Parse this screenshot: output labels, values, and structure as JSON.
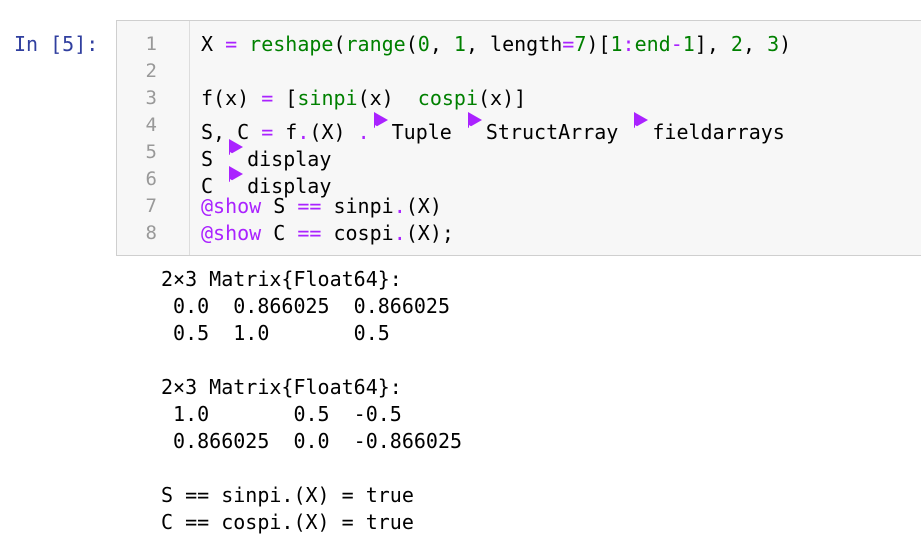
{
  "prompt": "In [5]:",
  "code": {
    "line_numbers": [
      "1",
      "2",
      "3",
      "4",
      "5",
      "6",
      "7",
      "8"
    ],
    "lines": [
      [
        {
          "t": "X",
          "c": "#000"
        },
        {
          "t": " = ",
          "c": "#aa22ff"
        },
        {
          "t": "reshape",
          "c": "#008000"
        },
        {
          "t": "(",
          "c": "#000"
        },
        {
          "t": "range",
          "c": "#008000"
        },
        {
          "t": "(",
          "c": "#000"
        },
        {
          "t": "0",
          "c": "#008000"
        },
        {
          "t": ", ",
          "c": "#000"
        },
        {
          "t": "1",
          "c": "#008000"
        },
        {
          "t": ", length",
          "c": "#000"
        },
        {
          "t": "=",
          "c": "#aa22ff"
        },
        {
          "t": "7",
          "c": "#008000"
        },
        {
          "t": ")[",
          "c": "#000"
        },
        {
          "t": "1",
          "c": "#008000"
        },
        {
          "t": ":",
          "c": "#aa22ff"
        },
        {
          "t": "end",
          "c": "#008000"
        },
        {
          "t": "-",
          "c": "#aa22ff"
        },
        {
          "t": "1",
          "c": "#008000"
        },
        {
          "t": "], ",
          "c": "#000"
        },
        {
          "t": "2",
          "c": "#008000"
        },
        {
          "t": ", ",
          "c": "#000"
        },
        {
          "t": "3",
          "c": "#008000"
        },
        {
          "t": ")",
          "c": "#000"
        }
      ],
      [],
      [
        {
          "t": "f",
          "c": "#000"
        },
        {
          "t": "(x) ",
          "c": "#000"
        },
        {
          "t": "=",
          "c": "#aa22ff"
        },
        {
          "t": " [",
          "c": "#000"
        },
        {
          "t": "sinpi",
          "c": "#008000"
        },
        {
          "t": "(x)  ",
          "c": "#000"
        },
        {
          "t": "cospi",
          "c": "#008000"
        },
        {
          "t": "(x)]",
          "c": "#000"
        }
      ],
      [
        {
          "t": "S, C ",
          "c": "#000"
        },
        {
          "t": "=",
          "c": "#aa22ff"
        },
        {
          "t": " f",
          "c": "#000"
        },
        {
          "t": ".",
          "c": "#aa22ff"
        },
        {
          "t": "(X) ",
          "c": "#000"
        },
        {
          "t": ".",
          "c": "#aa22ff"
        },
        {
          "tri": true
        },
        {
          "t": "Tuple ",
          "c": "#000"
        },
        {
          "tri": true
        },
        {
          "t": "StructArray ",
          "c": "#000"
        },
        {
          "tri": true
        },
        {
          "t": "fieldarrays",
          "c": "#000"
        }
      ],
      [
        {
          "t": "S ",
          "c": "#000"
        },
        {
          "tri": true
        },
        {
          "t": "display",
          "c": "#000"
        }
      ],
      [
        {
          "t": "C ",
          "c": "#000"
        },
        {
          "tri": true
        },
        {
          "t": "display",
          "c": "#000"
        }
      ],
      [
        {
          "t": "@show",
          "c": "#aa22ff"
        },
        {
          "t": " S ",
          "c": "#000"
        },
        {
          "t": "==",
          "c": "#aa22ff"
        },
        {
          "t": " sinpi",
          "c": "#000"
        },
        {
          "t": ".",
          "c": "#aa22ff"
        },
        {
          "t": "(X)",
          "c": "#000"
        }
      ],
      [
        {
          "t": "@show",
          "c": "#aa22ff"
        },
        {
          "t": " C ",
          "c": "#000"
        },
        {
          "t": "==",
          "c": "#aa22ff"
        },
        {
          "t": " cospi",
          "c": "#000"
        },
        {
          "t": ".",
          "c": "#aa22ff"
        },
        {
          "t": "(X);",
          "c": "#000"
        }
      ]
    ]
  },
  "output": {
    "lines": [
      "2×3 Matrix{Float64}:",
      " 0.0  0.866025  0.866025",
      " 0.5  1.0       0.5",
      "",
      "2×3 Matrix{Float64}:",
      " 1.0       0.5  -0.5",
      " 0.866025  0.0  -0.866025",
      "",
      "S == sinpi.(X) = true",
      "C == cospi.(X) = true"
    ]
  }
}
